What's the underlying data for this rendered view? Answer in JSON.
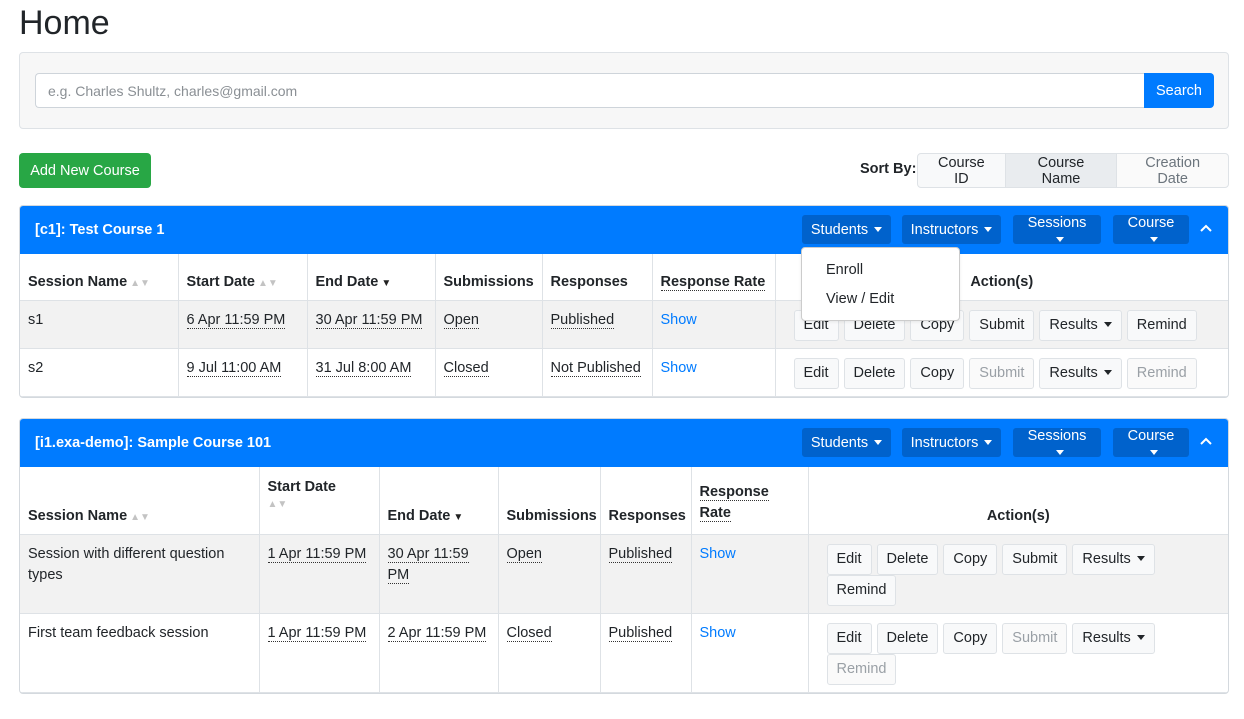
{
  "page_title": "Home",
  "search": {
    "placeholder": "e.g. Charles Shultz, charles@gmail.com",
    "button": "Search"
  },
  "add_course_button": "Add New Course",
  "sort": {
    "label": "Sort By:",
    "options": [
      "Course ID",
      "Course Name",
      "Creation Date"
    ],
    "selected": "Course Name"
  },
  "colors": {
    "primary": "#007bff",
    "success": "#28a745"
  },
  "courses": [
    {
      "title": "[c1]: Test Course 1",
      "menus": [
        "Students",
        "Instructors",
        "Sessions",
        "Course"
      ],
      "columns": [
        "Session Name",
        "Start Date",
        "End Date",
        "Submissions",
        "Responses",
        "Response Rate",
        "Action(s)"
      ],
      "sessions": [
        {
          "name": "s1",
          "start": "6 Apr 11:59 PM",
          "end": "30 Apr 11:59 PM",
          "submissions": "Open",
          "responses": "Published",
          "rate": "Show"
        },
        {
          "name": "s2",
          "start": "9 Jul 11:00 AM",
          "end": "31 Jul 8:00 AM",
          "submissions": "Closed",
          "responses": "Not Published",
          "rate": "Show"
        }
      ]
    },
    {
      "title": "[i1.exa-demo]: Sample Course 101",
      "menus": [
        "Students",
        "Instructors",
        "Sessions",
        "Course"
      ],
      "columns": [
        "Session Name",
        "Start Date",
        "End Date",
        "Submissions",
        "Responses",
        "Response Rate",
        "Action(s)"
      ],
      "sessions": [
        {
          "name": "Session with different question types",
          "start": "1 Apr 11:59 PM",
          "end": "30 Apr 11:59 PM",
          "submissions": "Open",
          "responses": "Published",
          "rate": "Show"
        },
        {
          "name": "First team feedback session",
          "start": "1 Apr 11:59 PM",
          "end": "2 Apr 11:59 PM",
          "submissions": "Closed",
          "responses": "Published",
          "rate": "Show"
        }
      ]
    }
  ],
  "actions": [
    "Edit",
    "Delete",
    "Copy",
    "Submit",
    "Results",
    "Remind"
  ],
  "students_dropdown": [
    "Enroll",
    "View / Edit"
  ]
}
